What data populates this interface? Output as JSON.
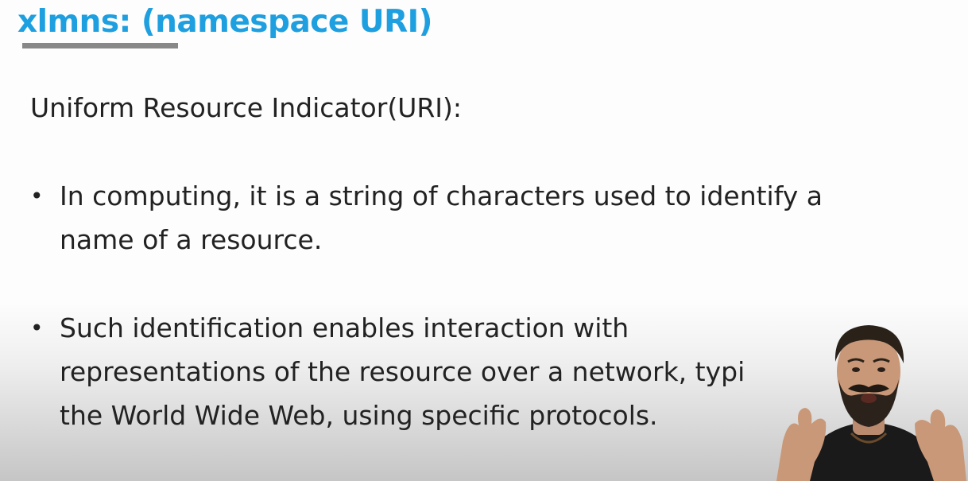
{
  "slide": {
    "title": "xlmns: (namespace URI)",
    "title_color": "#1E9FE0",
    "subheading": "Uniform Resource Indicator(URI):",
    "bullet_symbol": "•",
    "bullets": [
      {
        "lines": [
          "In computing, it is a string of characters used to identify a",
          "name of a resource."
        ]
      },
      {
        "lines": [
          "Such identification enables interaction with",
          "representations of the resource over a network, typi",
          "the World Wide Web, using specific protocols."
        ]
      }
    ]
  },
  "presenter": {
    "icon": "presenter-video-overlay"
  }
}
